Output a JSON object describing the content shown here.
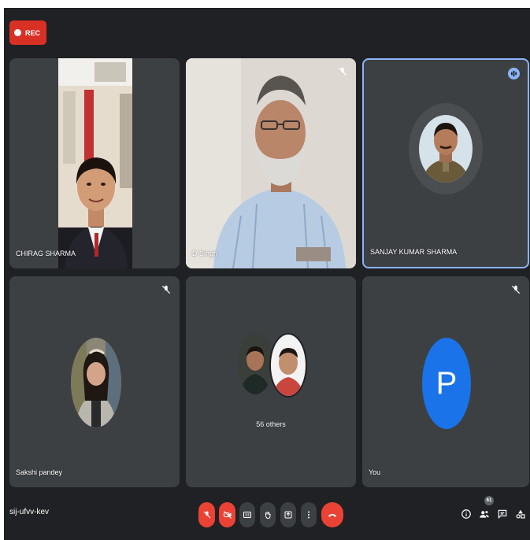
{
  "rec_label": "REC",
  "meeting_code": "sij-ufvv-kev",
  "participant_count": "61",
  "tiles": {
    "chirag": {
      "name": "CHIRAG SHARMA"
    },
    "dsingh": {
      "name": "D Singh"
    },
    "sanjay": {
      "name": "SANJAY KUMAR SHARMA"
    },
    "sakshi": {
      "name": "Sakshi pandey"
    },
    "others": {
      "label": "56 others"
    },
    "you": {
      "name": "You",
      "initial": "P"
    }
  },
  "controls": [
    "microphone-off",
    "camera-off",
    "captions",
    "raise-hand",
    "present",
    "more-options",
    "leave-call"
  ],
  "right_controls": [
    "info",
    "people",
    "chat",
    "activities"
  ],
  "colors": {
    "background": "#202124",
    "tile": "#3c4043",
    "danger": "#ea4335",
    "accent": "#8ab4f8",
    "you_avatar": "#1a73e8"
  }
}
